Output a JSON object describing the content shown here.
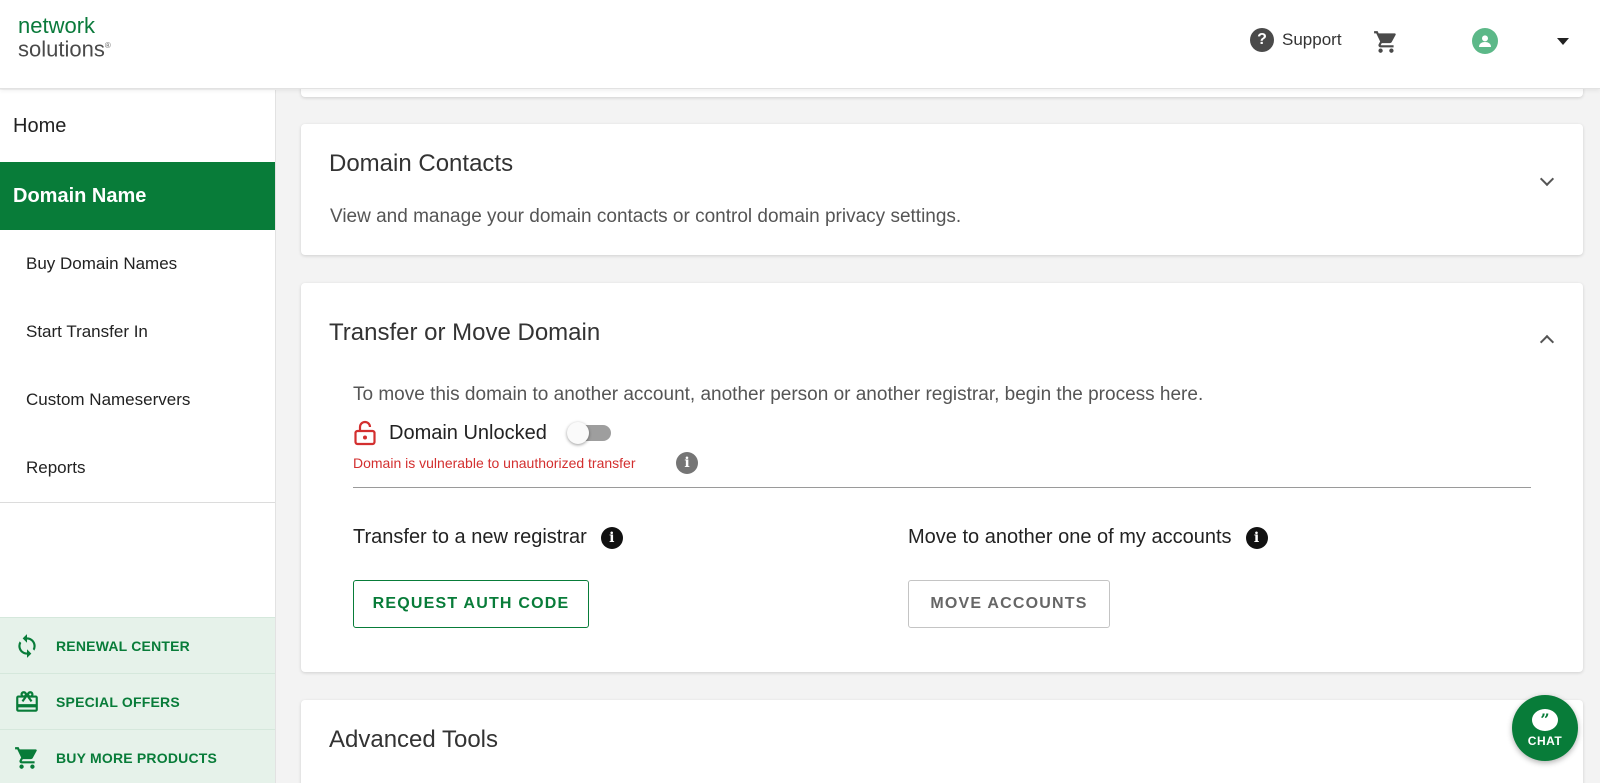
{
  "header": {
    "logo_line1": "network",
    "logo_line2": "solutions",
    "logo_mark": "®",
    "support_label": "Support",
    "support_icon": "question-circle-icon",
    "cart_icon": "cart-icon",
    "avatar_icon": "user-avatar-icon"
  },
  "sidebar": {
    "home": "Home",
    "active_section": "Domain Name",
    "items": [
      {
        "label": "Buy Domain Names"
      },
      {
        "label": "Start Transfer In"
      },
      {
        "label": "Custom Nameservers"
      },
      {
        "label": "Reports"
      }
    ],
    "bottom_links": [
      {
        "label": "RENEWAL CENTER",
        "icon": "refresh-icon"
      },
      {
        "label": "SPECIAL OFFERS",
        "icon": "gift-icon"
      },
      {
        "label": "BUY MORE PRODUCTS",
        "icon": "cart-icon"
      }
    ]
  },
  "domain_contacts": {
    "title": "Domain Contacts",
    "description": "View and manage your domain contacts or control domain privacy settings."
  },
  "transfer": {
    "title": "Transfer or Move Domain",
    "description": "To move this domain to another account, another person or another registrar, begin the process here.",
    "lock_label": "Domain Unlocked",
    "lock_enabled": false,
    "warning": "Domain is vulnerable to unauthorized transfer",
    "registrar_heading": "Transfer to a new registrar",
    "registrar_button": "REQUEST AUTH CODE",
    "accounts_heading": "Move to another one of my accounts",
    "accounts_button": "MOVE ACCOUNTS"
  },
  "advanced_tools": {
    "title": "Advanced Tools"
  },
  "chat": {
    "label": "CHAT"
  },
  "colors": {
    "brand_green": "#087c39",
    "warning_red": "#d32f2f",
    "sidebar_light_green": "#e6f2ea"
  }
}
